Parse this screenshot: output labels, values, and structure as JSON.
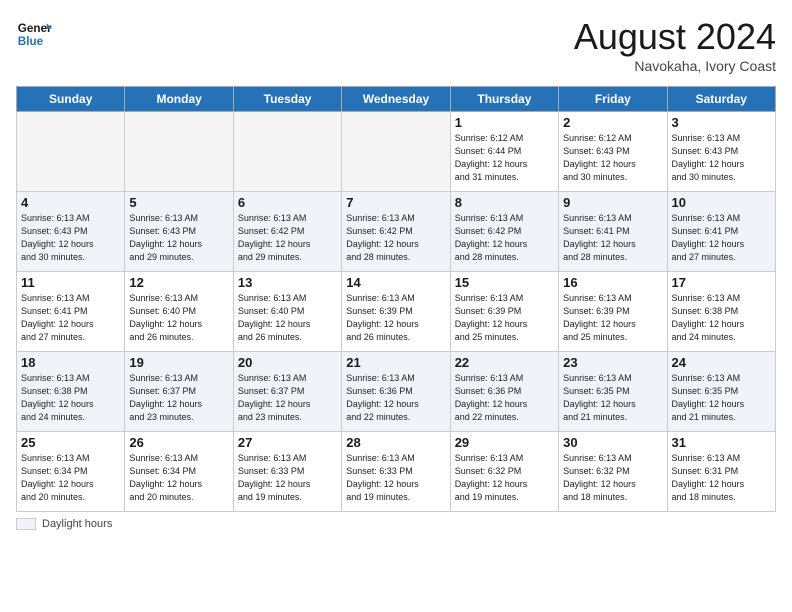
{
  "header": {
    "logo_line1": "General",
    "logo_line2": "Blue",
    "month": "August 2024",
    "location": "Navokaha, Ivory Coast"
  },
  "days_of_week": [
    "Sunday",
    "Monday",
    "Tuesday",
    "Wednesday",
    "Thursday",
    "Friday",
    "Saturday"
  ],
  "weeks": [
    [
      {
        "day": "",
        "info": ""
      },
      {
        "day": "",
        "info": ""
      },
      {
        "day": "",
        "info": ""
      },
      {
        "day": "",
        "info": ""
      },
      {
        "day": "1",
        "info": "Sunrise: 6:12 AM\nSunset: 6:44 PM\nDaylight: 12 hours\nand 31 minutes."
      },
      {
        "day": "2",
        "info": "Sunrise: 6:12 AM\nSunset: 6:43 PM\nDaylight: 12 hours\nand 30 minutes."
      },
      {
        "day": "3",
        "info": "Sunrise: 6:13 AM\nSunset: 6:43 PM\nDaylight: 12 hours\nand 30 minutes."
      }
    ],
    [
      {
        "day": "4",
        "info": "Sunrise: 6:13 AM\nSunset: 6:43 PM\nDaylight: 12 hours\nand 30 minutes."
      },
      {
        "day": "5",
        "info": "Sunrise: 6:13 AM\nSunset: 6:43 PM\nDaylight: 12 hours\nand 29 minutes."
      },
      {
        "day": "6",
        "info": "Sunrise: 6:13 AM\nSunset: 6:42 PM\nDaylight: 12 hours\nand 29 minutes."
      },
      {
        "day": "7",
        "info": "Sunrise: 6:13 AM\nSunset: 6:42 PM\nDaylight: 12 hours\nand 28 minutes."
      },
      {
        "day": "8",
        "info": "Sunrise: 6:13 AM\nSunset: 6:42 PM\nDaylight: 12 hours\nand 28 minutes."
      },
      {
        "day": "9",
        "info": "Sunrise: 6:13 AM\nSunset: 6:41 PM\nDaylight: 12 hours\nand 28 minutes."
      },
      {
        "day": "10",
        "info": "Sunrise: 6:13 AM\nSunset: 6:41 PM\nDaylight: 12 hours\nand 27 minutes."
      }
    ],
    [
      {
        "day": "11",
        "info": "Sunrise: 6:13 AM\nSunset: 6:41 PM\nDaylight: 12 hours\nand 27 minutes."
      },
      {
        "day": "12",
        "info": "Sunrise: 6:13 AM\nSunset: 6:40 PM\nDaylight: 12 hours\nand 26 minutes."
      },
      {
        "day": "13",
        "info": "Sunrise: 6:13 AM\nSunset: 6:40 PM\nDaylight: 12 hours\nand 26 minutes."
      },
      {
        "day": "14",
        "info": "Sunrise: 6:13 AM\nSunset: 6:39 PM\nDaylight: 12 hours\nand 26 minutes."
      },
      {
        "day": "15",
        "info": "Sunrise: 6:13 AM\nSunset: 6:39 PM\nDaylight: 12 hours\nand 25 minutes."
      },
      {
        "day": "16",
        "info": "Sunrise: 6:13 AM\nSunset: 6:39 PM\nDaylight: 12 hours\nand 25 minutes."
      },
      {
        "day": "17",
        "info": "Sunrise: 6:13 AM\nSunset: 6:38 PM\nDaylight: 12 hours\nand 24 minutes."
      }
    ],
    [
      {
        "day": "18",
        "info": "Sunrise: 6:13 AM\nSunset: 6:38 PM\nDaylight: 12 hours\nand 24 minutes."
      },
      {
        "day": "19",
        "info": "Sunrise: 6:13 AM\nSunset: 6:37 PM\nDaylight: 12 hours\nand 23 minutes."
      },
      {
        "day": "20",
        "info": "Sunrise: 6:13 AM\nSunset: 6:37 PM\nDaylight: 12 hours\nand 23 minutes."
      },
      {
        "day": "21",
        "info": "Sunrise: 6:13 AM\nSunset: 6:36 PM\nDaylight: 12 hours\nand 22 minutes."
      },
      {
        "day": "22",
        "info": "Sunrise: 6:13 AM\nSunset: 6:36 PM\nDaylight: 12 hours\nand 22 minutes."
      },
      {
        "day": "23",
        "info": "Sunrise: 6:13 AM\nSunset: 6:35 PM\nDaylight: 12 hours\nand 21 minutes."
      },
      {
        "day": "24",
        "info": "Sunrise: 6:13 AM\nSunset: 6:35 PM\nDaylight: 12 hours\nand 21 minutes."
      }
    ],
    [
      {
        "day": "25",
        "info": "Sunrise: 6:13 AM\nSunset: 6:34 PM\nDaylight: 12 hours\nand 20 minutes."
      },
      {
        "day": "26",
        "info": "Sunrise: 6:13 AM\nSunset: 6:34 PM\nDaylight: 12 hours\nand 20 minutes."
      },
      {
        "day": "27",
        "info": "Sunrise: 6:13 AM\nSunset: 6:33 PM\nDaylight: 12 hours\nand 19 minutes."
      },
      {
        "day": "28",
        "info": "Sunrise: 6:13 AM\nSunset: 6:33 PM\nDaylight: 12 hours\nand 19 minutes."
      },
      {
        "day": "29",
        "info": "Sunrise: 6:13 AM\nSunset: 6:32 PM\nDaylight: 12 hours\nand 19 minutes."
      },
      {
        "day": "30",
        "info": "Sunrise: 6:13 AM\nSunset: 6:32 PM\nDaylight: 12 hours\nand 18 minutes."
      },
      {
        "day": "31",
        "info": "Sunrise: 6:13 AM\nSunset: 6:31 PM\nDaylight: 12 hours\nand 18 minutes."
      }
    ]
  ],
  "footer": {
    "label": "Daylight hours"
  }
}
